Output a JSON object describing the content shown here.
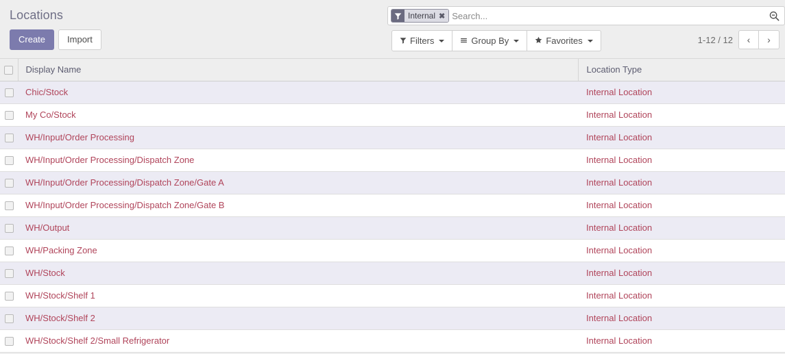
{
  "header": {
    "title": "Locations",
    "create_label": "Create",
    "import_label": "Import"
  },
  "search": {
    "placeholder": "Search...",
    "value": "",
    "facet": {
      "icon": "filter-icon",
      "label": "Internal",
      "remove_label": "✖"
    },
    "search_icon": "search-zoom-out-icon"
  },
  "toolbar": {
    "filters_label": "Filters",
    "group_by_label": "Group By",
    "favorites_label": "Favorites",
    "filters_icon": "funnel-icon",
    "group_by_icon": "bars-icon",
    "favorites_icon": "star-icon"
  },
  "pager": {
    "range": "1-12 / 12",
    "prev_label": "‹",
    "next_label": "›"
  },
  "table": {
    "columns": [
      {
        "key": "display_name",
        "label": "Display Name"
      },
      {
        "key": "location_type",
        "label": "Location Type"
      }
    ],
    "rows": [
      {
        "display_name": "Chic/Stock",
        "location_type": "Internal Location"
      },
      {
        "display_name": "My Co/Stock",
        "location_type": "Internal Location"
      },
      {
        "display_name": "WH/Input/Order Processing",
        "location_type": "Internal Location"
      },
      {
        "display_name": "WH/Input/Order Processing/Dispatch Zone",
        "location_type": "Internal Location"
      },
      {
        "display_name": "WH/Input/Order Processing/Dispatch Zone/Gate A",
        "location_type": "Internal Location"
      },
      {
        "display_name": "WH/Input/Order Processing/Dispatch Zone/Gate B",
        "location_type": "Internal Location"
      },
      {
        "display_name": "WH/Output",
        "location_type": "Internal Location"
      },
      {
        "display_name": "WH/Packing Zone",
        "location_type": "Internal Location"
      },
      {
        "display_name": "WH/Stock",
        "location_type": "Internal Location"
      },
      {
        "display_name": "WH/Stock/Shelf 1",
        "location_type": "Internal Location"
      },
      {
        "display_name": "WH/Stock/Shelf 2",
        "location_type": "Internal Location"
      },
      {
        "display_name": "WH/Stock/Shelf 2/Small Refrigerator",
        "location_type": "Internal Location"
      }
    ]
  },
  "colors": {
    "primary": "#7c7bad",
    "link": "#b0445a",
    "row_alt": "#ecebf4",
    "panel_bg": "#eeeeee"
  }
}
